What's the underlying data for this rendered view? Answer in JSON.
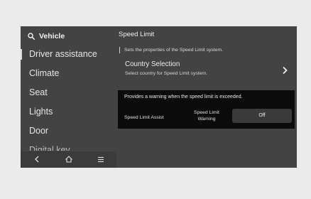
{
  "sidebar": {
    "search_label": "Vehicle",
    "items": [
      {
        "label": "Driver assistance",
        "active": true
      },
      {
        "label": "Climate"
      },
      {
        "label": "Seat"
      },
      {
        "label": "Lights"
      },
      {
        "label": "Door"
      },
      {
        "label": "Digital key"
      }
    ],
    "bottom_icons": [
      "back-icon",
      "home-icon",
      "menu-icon"
    ]
  },
  "content": {
    "title": "Speed Limit",
    "description": "Sets the properties of the Speed Limit system.",
    "country": {
      "title": "Country Selection",
      "subtitle": "Select country for Speed Limit system."
    },
    "warning_panel": {
      "text": "Provides a warning when the speed limit is exceeded.",
      "assist_label": "Speed Limit Assist",
      "warning_label": "Speed Limit Warning",
      "button_label": "Off"
    }
  },
  "colors": {
    "background": "#ebebeb",
    "screen": "#434343",
    "panel": "#0b0b0b",
    "button": "#3a3a3a"
  }
}
